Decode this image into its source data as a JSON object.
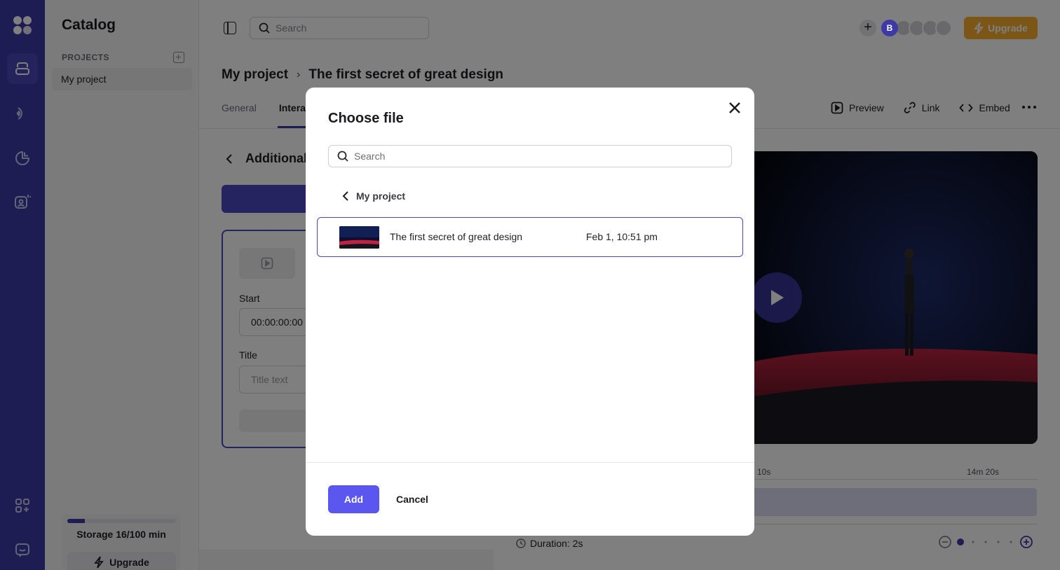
{
  "sidebar": {
    "title": "Catalog",
    "projects_label": "PROJECTS",
    "items": [
      {
        "label": "My project"
      }
    ],
    "storage": {
      "label": "Storage 16/100 min",
      "used_fraction": 0.16
    },
    "upgrade_label": "Upgrade"
  },
  "rail": {
    "icons": [
      "logo-icon",
      "catalog-icon",
      "broadcast-icon",
      "analytics-icon",
      "ai-avatar-icon",
      "apps-icon",
      "chat-icon"
    ]
  },
  "header": {
    "search_placeholder": "Search",
    "avatar_initial": "B",
    "upgrade_label": "Upgrade"
  },
  "breadcrumb": {
    "project": "My project",
    "separator": "›",
    "video": "The first secret of great design"
  },
  "tabs": [
    {
      "label": "General"
    },
    {
      "label": "Interac"
    }
  ],
  "actions": {
    "preview": "Preview",
    "link": "Link",
    "embed": "Embed"
  },
  "panel": {
    "heading": "Additional",
    "start_label": "Start",
    "start_value": "00:00:00:00",
    "title_label": "Title",
    "title_placeholder": "Title text"
  },
  "timeline": {
    "label_1": "10s",
    "label_2": "14m 20s",
    "duration": "Duration: 2s"
  },
  "modal": {
    "title": "Choose file",
    "search_placeholder": "Search",
    "folder": "My project",
    "files": [
      {
        "name": "The first secret of great design",
        "date": "Feb 1, 10:51 pm"
      }
    ],
    "add_label": "Add",
    "cancel_label": "Cancel"
  },
  "colors": {
    "brand": "#3d3aa6",
    "accent": "#5b56f0",
    "upgrade": "#f7ad2d"
  }
}
